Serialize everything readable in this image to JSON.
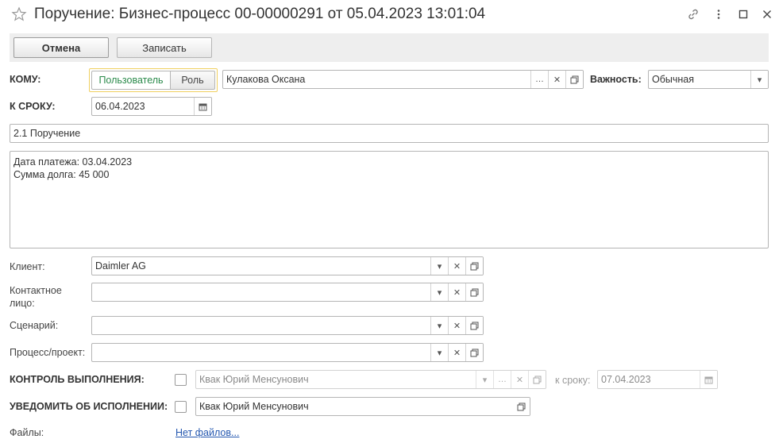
{
  "window": {
    "title": "Поручение: Бизнес-процесс 00-00000291 от 05.04.2023 13:01:04"
  },
  "toolbar": {
    "cancel_label": "Отмена",
    "save_label": "Записать"
  },
  "form": {
    "to": {
      "label": "КОМУ:",
      "toggle_user": "Пользователь",
      "toggle_role": "Роль",
      "value": "Кулакова Оксана"
    },
    "importance": {
      "label": "Важность:",
      "value": "Обычная"
    },
    "deadline": {
      "label": "К СРОКУ:",
      "value": "06.04.2023"
    },
    "subject": "2.1 Поручение",
    "body_lines": [
      "Дата платежа: 03.04.2023",
      "Сумма долга: 45 000"
    ],
    "client": {
      "label": "Клиент:",
      "value": "Daimler AG"
    },
    "contact": {
      "label_line1": "Контактное",
      "label_line2": "лицо:",
      "value": ""
    },
    "scenario": {
      "label": "Сценарий:",
      "value": ""
    },
    "process": {
      "label": "Процесс/проект:",
      "value": ""
    },
    "control": {
      "label": "КОНТРОЛЬ ВЫПОЛНЕНИЯ:",
      "checked": false,
      "value": "Квак Юрий Менсунович",
      "deadline_label": "к сроку:",
      "deadline_value": "07.04.2023"
    },
    "notify": {
      "label": "УВЕДОМИТЬ ОБ ИСПОЛНЕНИИ:",
      "checked": false,
      "value": "Квак Юрий Менсунович"
    },
    "files": {
      "label": "Файлы:",
      "link": "Нет файлов..."
    }
  },
  "colors": {
    "toolbar_bg": "#eeeeee",
    "active_toggle_text": "#2a8a4a",
    "toggle_border": "#f0d060",
    "link": "#2558b0"
  },
  "icons": {
    "favorite": "star-icon",
    "link": "link-icon",
    "more": "more-vertical-icon",
    "maximize": "maximize-icon",
    "close": "close-icon",
    "calendar": "calendar-icon",
    "dropdown": "dropdown-arrow-icon",
    "clear": "clear-icon",
    "open": "open-form-icon",
    "select": "select-ellipsis-icon"
  }
}
